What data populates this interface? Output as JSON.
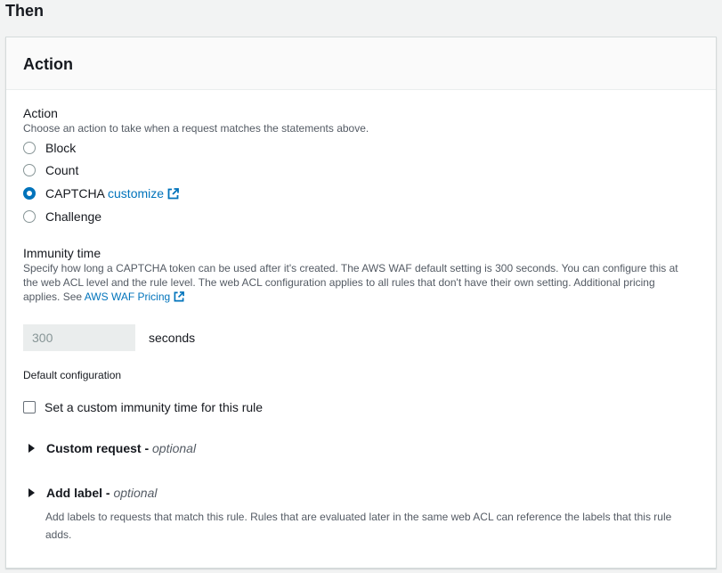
{
  "section_title": "Then",
  "panel": {
    "title": "Action",
    "action": {
      "label": "Action",
      "description": "Choose an action to take when a request matches the statements above.",
      "options": [
        {
          "label": "Block",
          "checked": false
        },
        {
          "label": "Count",
          "checked": false
        },
        {
          "label": "CAPTCHA",
          "checked": true,
          "link": "customize"
        },
        {
          "label": "Challenge",
          "checked": false
        }
      ]
    },
    "immunity": {
      "label": "Immunity time",
      "description": "Specify how long a CAPTCHA token can be used after it's created. The AWS WAF default setting is 300 seconds. You can configure this at the web ACL level and the rule level. The web ACL configuration applies to all rules that don't have their own setting. Additional pricing applies. See",
      "pricing_link": "AWS WAF Pricing",
      "value": "300",
      "unit": "seconds",
      "default_config_label": "Default configuration",
      "custom_checkbox_label": "Set a custom immunity time for this rule",
      "custom_checked": false
    },
    "custom_request": {
      "title": "Custom request -",
      "optional": "optional"
    },
    "add_label": {
      "title": "Add label -",
      "optional": "optional",
      "description": "Add labels to requests that match this rule. Rules that are evaluated later in the same web ACL can reference the labels that this rule adds."
    }
  },
  "colors": {
    "link": "#0073bb",
    "radio_checked": "#0073bb",
    "panel_bg": "#ffffff",
    "page_bg": "#f2f3f3"
  }
}
